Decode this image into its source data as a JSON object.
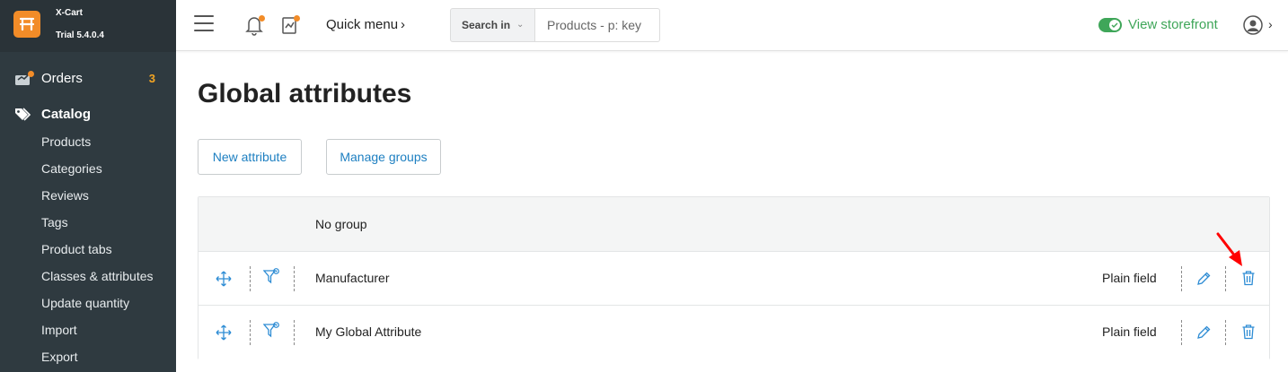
{
  "brand": {
    "name": "X-Cart",
    "version": "Trial 5.4.0.4"
  },
  "sidebar": {
    "orders": {
      "label": "Orders",
      "count": "3"
    },
    "catalog": {
      "label": "Catalog",
      "items": [
        {
          "label": "Products"
        },
        {
          "label": "Categories"
        },
        {
          "label": "Reviews"
        },
        {
          "label": "Tags"
        },
        {
          "label": "Product tabs"
        },
        {
          "label": "Classes & attributes"
        },
        {
          "label": "Update quantity"
        },
        {
          "label": "Import"
        },
        {
          "label": "Export"
        }
      ]
    }
  },
  "topbar": {
    "quick_menu": "Quick menu",
    "search_in": "Search in",
    "search_placeholder": "Products - p: key",
    "view_storefront": "View storefront"
  },
  "main": {
    "title": "Global attributes",
    "new_attribute": "New attribute",
    "manage_groups": "Manage groups",
    "group_label": "No group",
    "rows": [
      {
        "name": "Manufacturer",
        "type": "Plain field"
      },
      {
        "name": "My Global Attribute",
        "type": "Plain field"
      }
    ]
  },
  "colors": {
    "sidebar_bg": "#2f3a40",
    "accent_orange": "#f28c28",
    "link_blue": "#1d7fc1",
    "storefront_green": "#3fa659",
    "annotation_red": "#ff0000"
  },
  "icons": {
    "logo": "xcart-logo-icon",
    "orders": "orders-icon",
    "catalog": "tags-icon",
    "menu": "hamburger-icon",
    "notifications": "bell-icon",
    "messages": "document-icon",
    "user": "user-icon",
    "move": "move-icon",
    "filter": "filter-icon",
    "edit": "pencil-icon",
    "delete": "trash-icon"
  }
}
